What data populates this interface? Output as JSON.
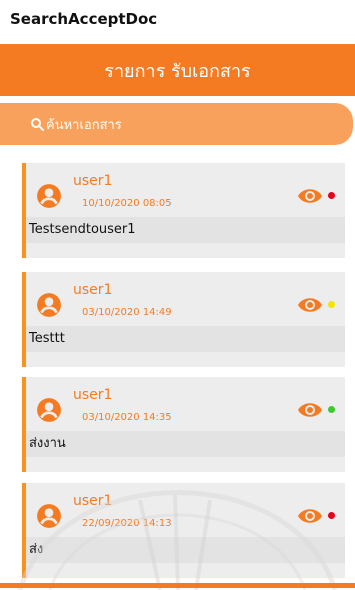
{
  "app": {
    "title": "SearchAcceptDoc"
  },
  "header": {
    "title": "รายการ รับเอกสาร"
  },
  "search": {
    "placeholder": "ค้นหาเอกสาร"
  },
  "colors": {
    "accent": "#F57B22",
    "card_bg": "#EDEDED",
    "status_red": "#E8001F",
    "status_yellow": "#F4E400",
    "status_green": "#3ACB2E"
  },
  "cards": [
    {
      "user": "user1",
      "datetime": "10/10/2020 08:05",
      "subject": "Testsendtouser1",
      "status": "red"
    },
    {
      "user": "user1",
      "datetime": "03/10/2020 14:49",
      "subject": "Testtt",
      "status": "yellow"
    },
    {
      "user": "user1",
      "datetime": "03/10/2020 14:35",
      "subject": "ส่งงาน",
      "status": "green"
    },
    {
      "user": "user1",
      "datetime": "22/09/2020 14:13",
      "subject": "ส่ง",
      "status": "red"
    }
  ]
}
